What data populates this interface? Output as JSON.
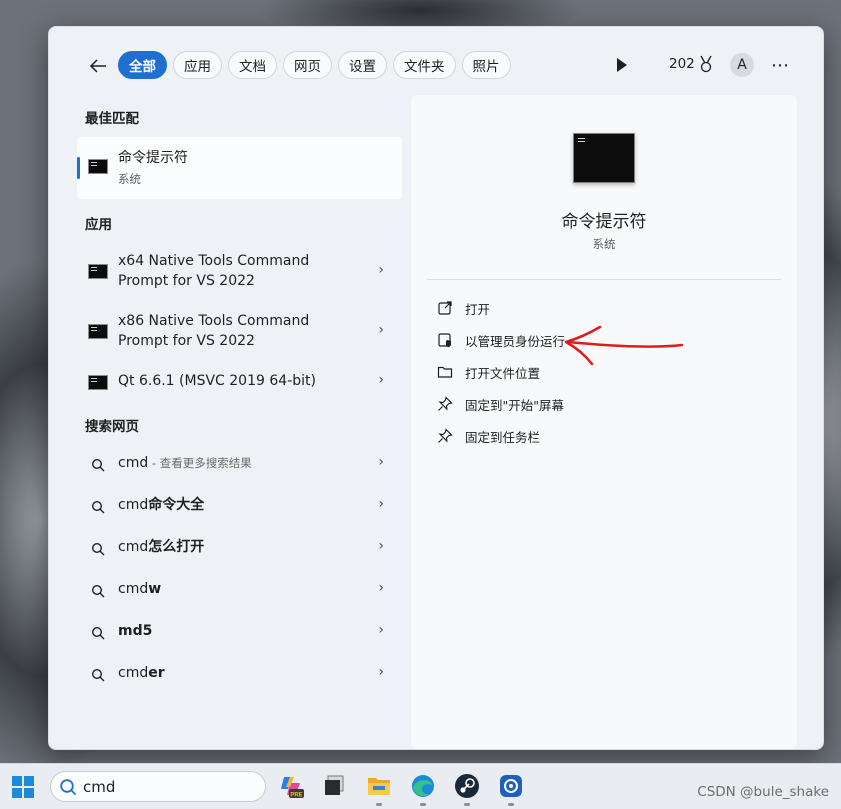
{
  "topbar": {
    "tabs": [
      {
        "label": "全部",
        "active": true
      },
      {
        "label": "应用",
        "active": false
      },
      {
        "label": "文档",
        "active": false
      },
      {
        "label": "网页",
        "active": false
      },
      {
        "label": "设置",
        "active": false
      },
      {
        "label": "文件夹",
        "active": false
      },
      {
        "label": "照片",
        "active": false
      }
    ],
    "points": "202",
    "avatar_letter": "A"
  },
  "left": {
    "best_match_title": "最佳匹配",
    "best_match": {
      "title": "命令提示符",
      "subtitle": "系统"
    },
    "apps_title": "应用",
    "apps": [
      {
        "line1": "x64 Native Tools Command",
        "line2": "Prompt for VS 2022"
      },
      {
        "line1": "x86 Native Tools Command",
        "line2": "Prompt for VS 2022"
      },
      {
        "line1": "Qt 6.6.1 (MSVC 2019 64-bit)"
      }
    ],
    "web_title": "搜索网页",
    "web": [
      {
        "typed": "cmd",
        "rest": "",
        "hint": " - 查看更多搜索结果"
      },
      {
        "typed": "cmd",
        "rest": "命令大全",
        "hint": ""
      },
      {
        "typed": "cmd",
        "rest": "怎么打开",
        "hint": ""
      },
      {
        "typed": "cmd",
        "rest": "w",
        "hint": ""
      },
      {
        "typed": "",
        "rest": "md5",
        "hint": ""
      },
      {
        "typed": "cmd",
        "rest": "er",
        "hint": ""
      }
    ]
  },
  "right": {
    "title": "命令提示符",
    "subtitle": "系统",
    "actions": [
      {
        "label": "打开",
        "icon": "open-external-icon"
      },
      {
        "label": "以管理员身份运行",
        "icon": "shield-admin-icon"
      },
      {
        "label": "打开文件位置",
        "icon": "folder-icon"
      },
      {
        "label": "固定到\"开始\"屏幕",
        "icon": "pin-icon"
      },
      {
        "label": "固定到任务栏",
        "icon": "pin-icon"
      }
    ]
  },
  "taskbar": {
    "search_value": "cmd",
    "apps": [
      "copilot-icon",
      "terminal-icon",
      "file-explorer-icon",
      "edge-icon",
      "steam-icon",
      "snipping-tool-icon"
    ]
  },
  "watermark": "CSDN @bule_shake",
  "colors": {
    "accent": "#1f6fd1",
    "annotation": "#e01b1b"
  }
}
